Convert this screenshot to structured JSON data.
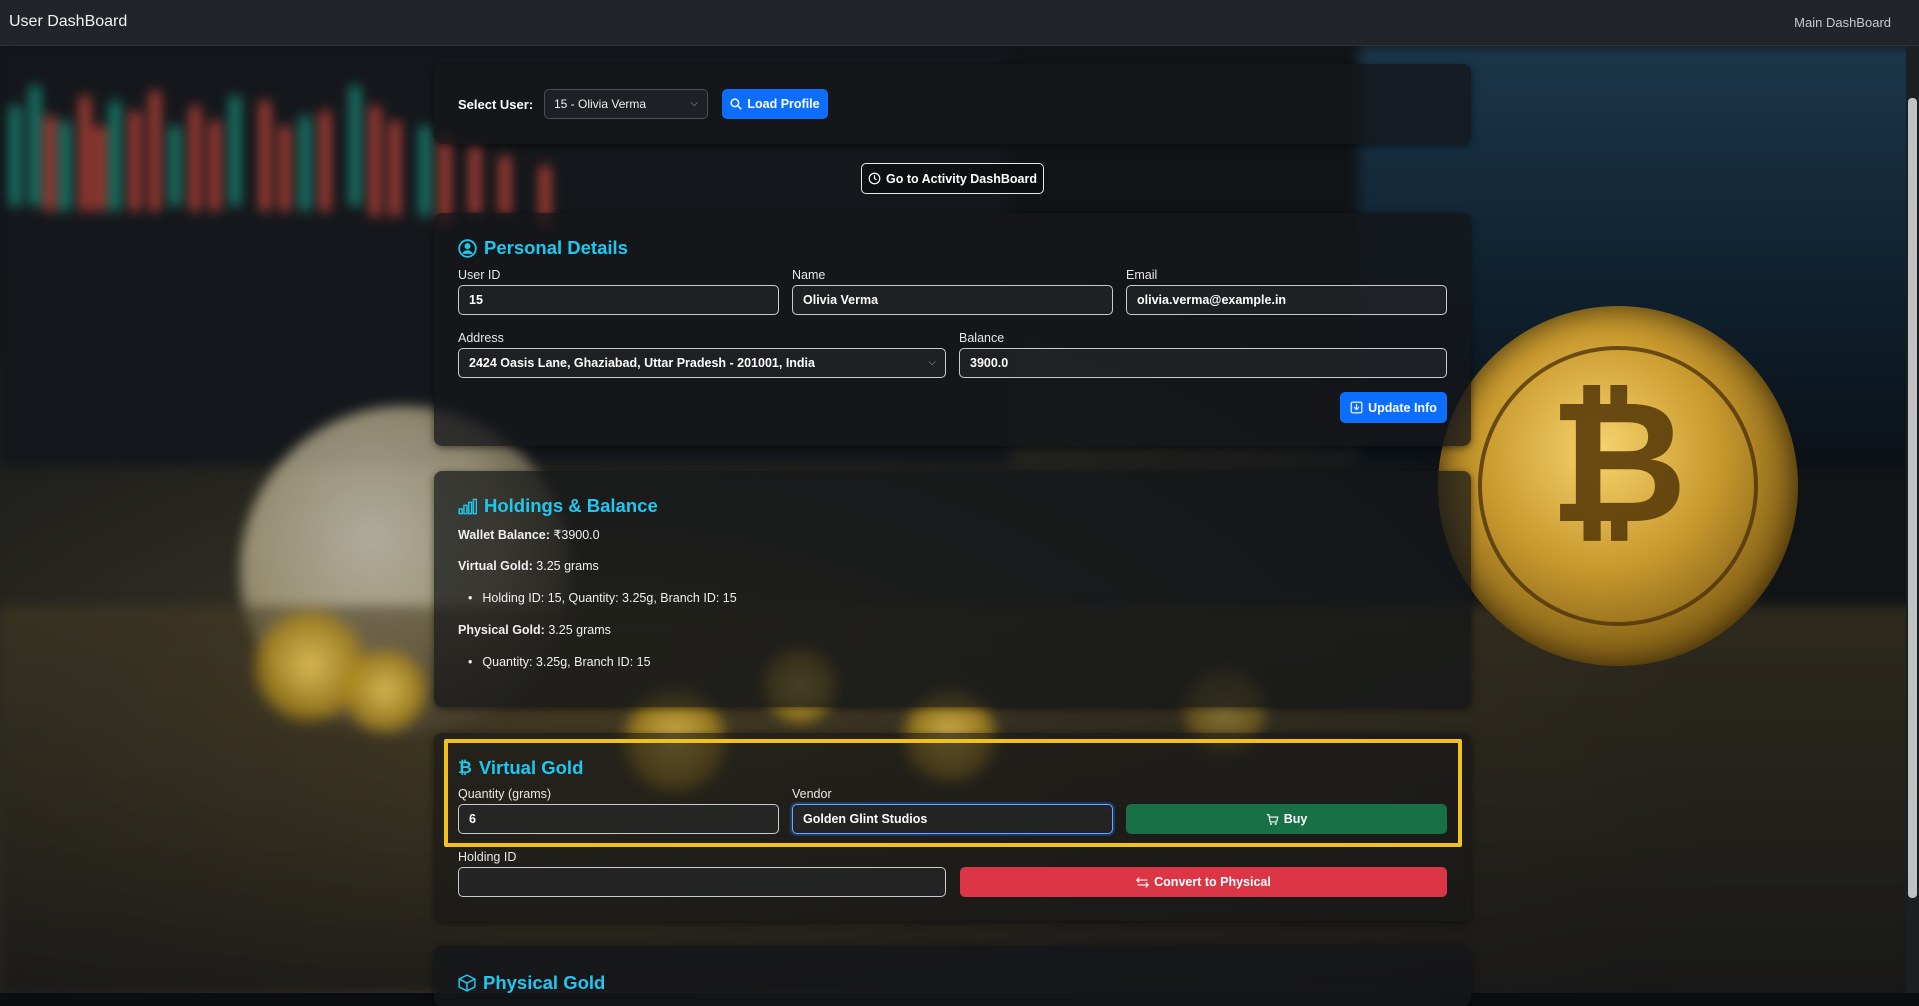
{
  "navbar": {
    "brand": "User DashBoard",
    "link": "Main DashBoard"
  },
  "select_user": {
    "label": "Select User:",
    "selected": "15 - Olivia Verma",
    "load_button": "Load Profile"
  },
  "activity_button": "Go to Activity DashBoard",
  "personal": {
    "title": "Personal Details",
    "user_id_label": "User ID",
    "user_id": "15",
    "name_label": "Name",
    "name": "Olivia Verma",
    "email_label": "Email",
    "email": "olivia.verma@example.in",
    "address_label": "Address",
    "address": "2424 Oasis Lane, Ghaziabad, Uttar Pradesh - 201001, India",
    "balance_label": "Balance",
    "balance": "3900.0",
    "update_button": "Update Info"
  },
  "holdings": {
    "title": "Holdings & Balance",
    "wallet_label": "Wallet Balance:",
    "wallet_value": "₹3900.0",
    "virtual_label": "Virtual Gold:",
    "virtual_value": "3.25 grams",
    "virtual_items": [
      "Holding ID: 15, Quantity: 3.25g, Branch ID: 15"
    ],
    "physical_label": "Physical Gold:",
    "physical_value": "3.25 grams",
    "physical_items": [
      "Quantity: 3.25g, Branch ID: 15"
    ]
  },
  "virtual_gold": {
    "title": "Virtual Gold",
    "quantity_label": "Quantity (grams)",
    "quantity": "6",
    "vendor_label": "Vendor",
    "vendor": "Golden Glint Studios",
    "buy_button": "Buy",
    "holding_label": "Holding ID",
    "holding_value": "",
    "convert_button": "Convert to Physical"
  },
  "physical_gold": {
    "title": "Physical Gold"
  },
  "colors": {
    "accent": "#1ec8f0",
    "primary": "#0d6efd",
    "success": "#177046",
    "danger": "#dc3545",
    "highlight": "#f2c11a"
  }
}
